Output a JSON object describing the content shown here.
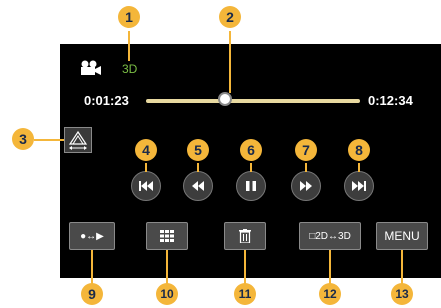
{
  "status": {
    "mode_3d_label": "3D",
    "mode_icon": "movie-camera-icon"
  },
  "playback": {
    "elapsed": "0:01:23",
    "total": "0:12:34",
    "progress": 0.37
  },
  "controls": {
    "prev_icon": "skip-previous-icon",
    "rewind_icon": "rewind-icon",
    "pause_icon": "pause-icon",
    "forward_icon": "fast-forward-icon",
    "next_icon": "skip-next-icon"
  },
  "buttons": {
    "mode_switch_label": "●↔▶",
    "index_icon": "grid-index-icon",
    "delete_icon": "trash-icon",
    "two_d_three_d_label": "□2D↔3D",
    "menu_label": "MENU"
  },
  "callouts": [
    "1",
    "2",
    "3",
    "4",
    "5",
    "6",
    "7",
    "8",
    "9",
    "10",
    "11",
    "12",
    "13"
  ],
  "colors": {
    "callout": "#f4b63a",
    "screen": "#000000",
    "track": "#e8d9a0",
    "mode_3d": "#7bbf45"
  }
}
